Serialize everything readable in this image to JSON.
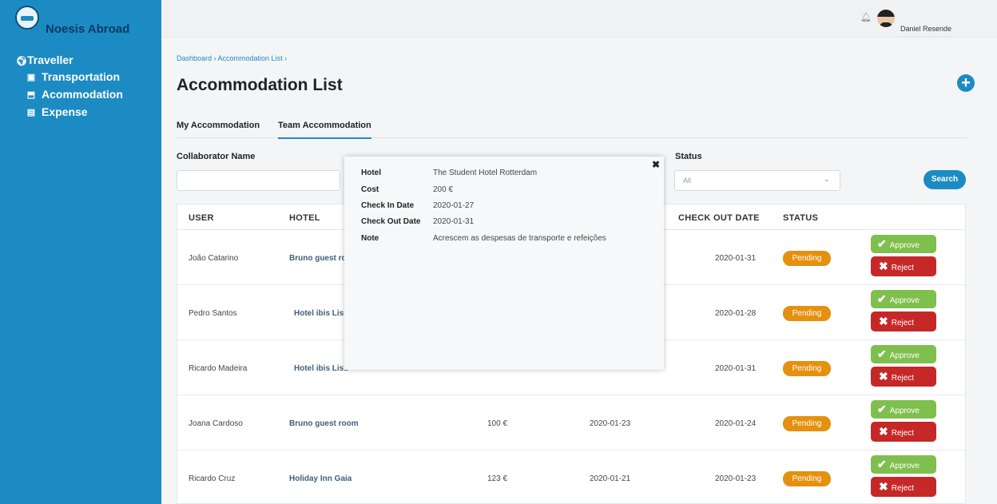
{
  "app": {
    "brand_name": "Noesis Abroad",
    "user_name": "Daniel Resende",
    "accent_color": "#1d8bc3"
  },
  "sidebar": {
    "title": "Traveller",
    "title_icon": "globe-icon",
    "items": [
      {
        "label": "Transportation",
        "icon": "briefcase-icon"
      },
      {
        "label": "Acommodation",
        "icon": "bed-icon"
      },
      {
        "label": "Expense",
        "icon": "money-icon"
      }
    ]
  },
  "breadcrumb": "Dashboard › Accommodation List ›",
  "page_title": "Accommodation List",
  "tabs": [
    {
      "label": "My Accommodation",
      "active": false
    },
    {
      "label": "Team Accommodation",
      "active": true
    }
  ],
  "filters": {
    "collaborator_label": "Collaborator Name",
    "collaborator_value": "",
    "status_label": "Status",
    "status_value": "All",
    "search_label": "Search"
  },
  "table": {
    "headers": [
      "USER",
      "HOTEL",
      "CHECK OUT DATE",
      "STATUS"
    ],
    "rows": [
      {
        "user": "João Catarino",
        "hotel": "Bruno guest ro",
        "cost": "",
        "checkin": "",
        "checkout": "2020-01-31",
        "status": "Pending"
      },
      {
        "user": "Pedro Santos",
        "hotel": "Hotel ibis Lisb",
        "cost": "",
        "checkin": "",
        "checkout": "2020-01-28",
        "status": "Pending"
      },
      {
        "user": "Ricardo Madeira",
        "hotel": "Hotel ibis Lisb",
        "cost": "",
        "checkin": "",
        "checkout": "2020-01-31",
        "status": "Pending"
      },
      {
        "user": "Joana Cardoso",
        "hotel": "Bruno guest room",
        "cost": "100 €",
        "checkin": "2020-01-23",
        "checkout": "2020-01-24",
        "status": "Pending"
      },
      {
        "user": "Ricardo Cruz",
        "hotel": "Holiday Inn Gaia",
        "cost": "123 €",
        "checkin": "2020-01-21",
        "checkout": "2020-01-23",
        "status": "Pending"
      }
    ],
    "approve_label": "Approve",
    "reject_label": "Reject"
  },
  "modal": {
    "fields": [
      {
        "key": "Hotel",
        "value": "The Student Hotel Rotterdam"
      },
      {
        "key": "Cost",
        "value": "200 €"
      },
      {
        "key": "Check In Date",
        "value": "2020-01-27"
      },
      {
        "key": "Check Out Date",
        "value": "2020-01-31"
      },
      {
        "key": "Note",
        "value": "Acrescem as despesas de transporte e refeições"
      }
    ],
    "close_symbol": "✖"
  }
}
